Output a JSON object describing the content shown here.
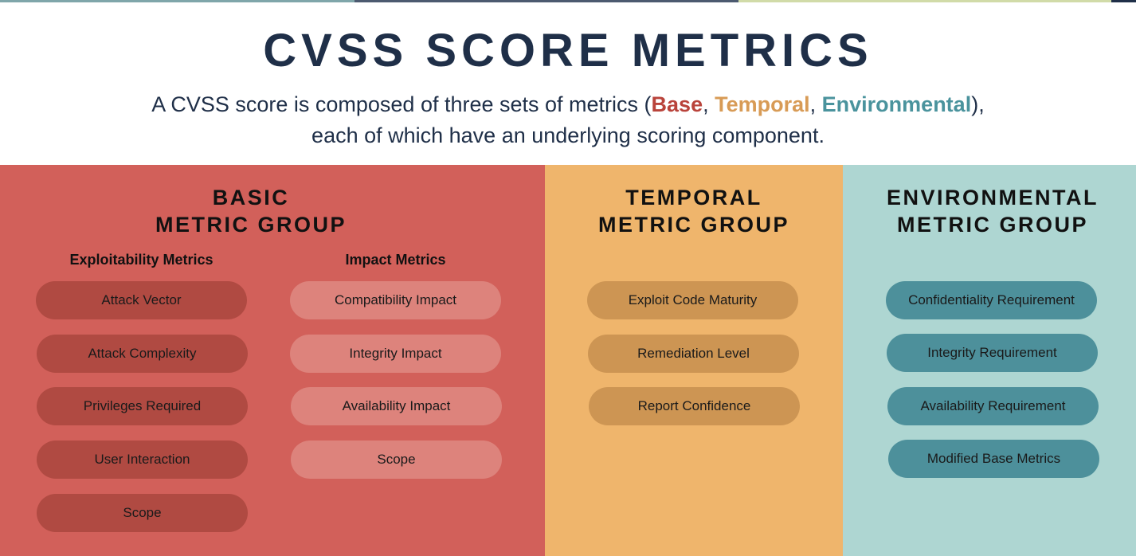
{
  "colors": {
    "base": "#b9433b",
    "temporal": "#d89b56",
    "environmental": "#4a939d",
    "title": "#1f2f48"
  },
  "header": {
    "title": "CVSS SCORE METRICS",
    "subtitle_pre": "A CVSS score is composed of three sets of metrics (",
    "kw_base": "Base",
    "sep1": ", ",
    "kw_temporal": "Temporal",
    "sep2": ", ",
    "kw_environmental": "Environmental",
    "subtitle_post": "),",
    "subtitle_line2": "each of which have an underlying scoring component."
  },
  "groups": {
    "basic": {
      "title_line1": "BASIC",
      "title_line2": "METRIC GROUP",
      "exploitability": {
        "heading": "Exploitability Metrics",
        "items": [
          "Attack Vector",
          "Attack Complexity",
          "Privileges Required",
          "User Interaction",
          "Scope"
        ]
      },
      "impact": {
        "heading": "Impact Metrics",
        "items": [
          "Compatibility Impact",
          "Integrity Impact",
          "Availability Impact",
          "Scope"
        ]
      }
    },
    "temporal": {
      "title_line1": "TEMPORAL",
      "title_line2": "METRIC GROUP",
      "items": [
        "Exploit Code Maturity",
        "Remediation Level",
        "Report Confidence"
      ]
    },
    "environmental": {
      "title_line1": "ENVIRONMENTAL",
      "title_line2": "METRIC GROUP",
      "items": [
        "Confidentiality Requirement",
        "Integrity Requirement",
        "Availability Requirement",
        "Modified Base Metrics"
      ]
    }
  }
}
